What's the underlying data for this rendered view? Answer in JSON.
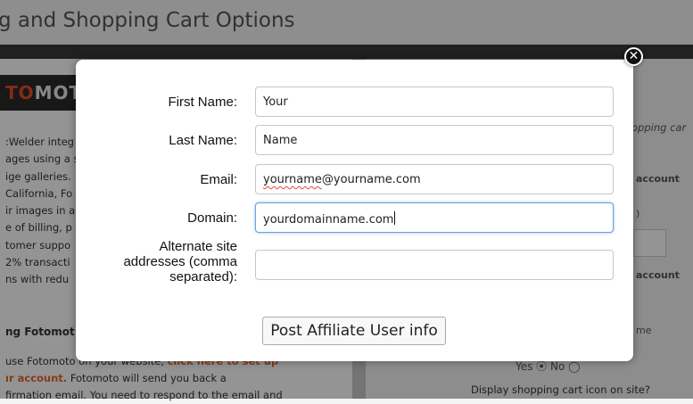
{
  "page": {
    "title": "g and Shopping Cart Options",
    "logo_highlight": "TO",
    "logo_rest": "MOT",
    "left_lines": [
      ":Welder integ",
      "ages using a s",
      "ige galleries.",
      "California, Fo",
      "ir images in a",
      "e of billing, p",
      "tomer suppo",
      "2% transacti",
      "ns with redu"
    ],
    "section_heading": "ng Fotomot",
    "bottom_lines": {
      "line1_start": "use Fotomoto",
      "line1_end": "on your website,",
      "line1_link": "click here to set up",
      "line2_link": "ır account.",
      "line2_rest": "Fotomoto will send you back a",
      "line3": "firmation email. You need to respond to the email and"
    },
    "right": {
      "italic_text": "opping car",
      "account_1": "account",
      "paren": ")",
      "account_2": "account",
      "me": "me",
      "yes_no": "Yes ⦿   No ◯",
      "display_cart": "Display shopping cart icon on site?"
    }
  },
  "modal": {
    "close_symbol": "✕",
    "labels": {
      "first_name": "First Name:",
      "last_name": "Last Name:",
      "email": "Email:",
      "domain": "Domain:",
      "alt_line1": "Alternate site",
      "alt_line2": "addresses (comma",
      "alt_line3": "separated):"
    },
    "values": {
      "first_name": "Your",
      "last_name": "Name",
      "email_misspelled": "yourname",
      "email_rest": "@yourname.com",
      "domain": "yourdomainname.com",
      "alternate": ""
    },
    "submit_label": "Post Affiliate User info"
  }
}
